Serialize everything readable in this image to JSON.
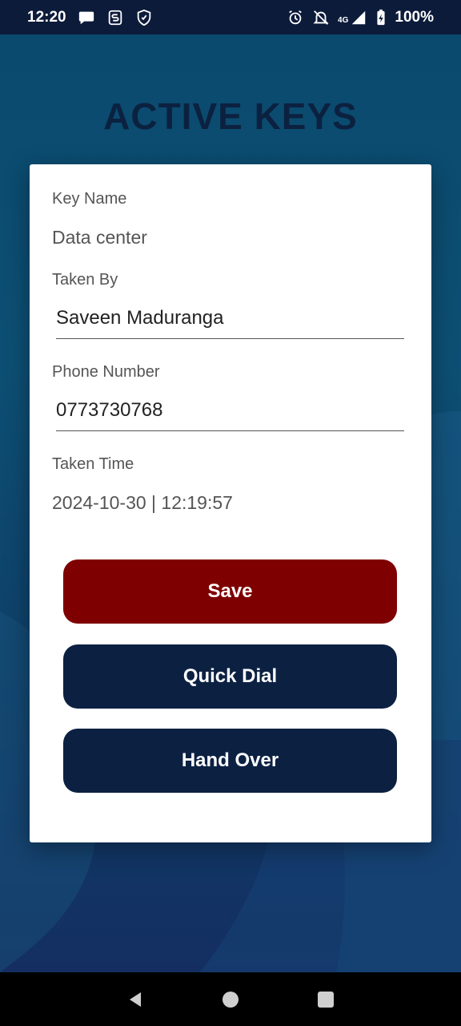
{
  "status_bar": {
    "time": "12:20",
    "network": "4G",
    "battery": "100%",
    "icons": [
      "chat-bubble-icon",
      "s-app-icon",
      "shield-hand-icon",
      "alarm-icon",
      "notifications-off-icon",
      "signal-icon",
      "battery-charging-icon"
    ]
  },
  "page": {
    "title": "ACTIVE KEYS"
  },
  "dialog": {
    "key_name_label": "Key Name",
    "key_name_value": "Data center",
    "taken_by_label": "Taken By",
    "taken_by_value": "Saveen Maduranga",
    "phone_label": "Phone Number",
    "phone_value": "0773730768",
    "taken_time_label": "Taken Time",
    "taken_time_value": "2024-10-30 | 12:19:57",
    "save_label": "Save",
    "quick_dial_label": "Quick Dial",
    "hand_over_label": "Hand Over"
  },
  "colors": {
    "save_button": "#7f0000",
    "dark_button": "#0c2142",
    "title": "#0c2140"
  },
  "nav_bar": {
    "icons": [
      "back-icon",
      "home-icon",
      "recents-icon"
    ]
  }
}
